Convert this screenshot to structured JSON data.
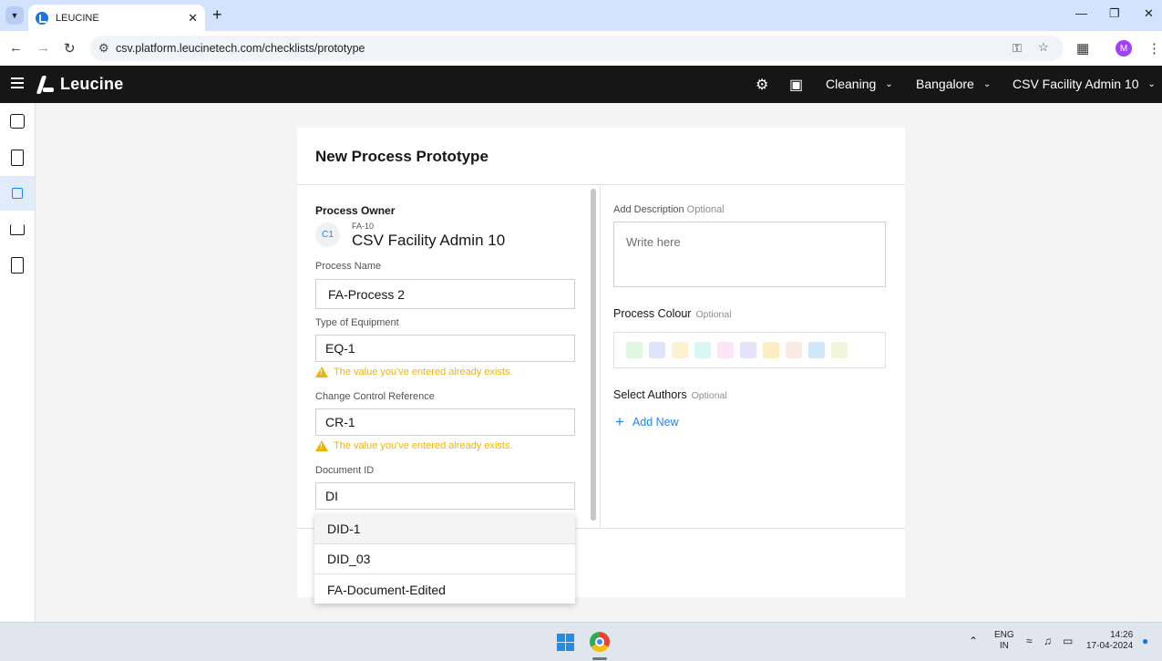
{
  "browser": {
    "tab_title": "LEUCINE",
    "url": "csv.platform.leucinetech.com/checklists/prototype",
    "profile_initial": "M"
  },
  "header": {
    "brand": "Leucine",
    "facility_use_case": "Cleaning",
    "location": "Bangalore",
    "user": "CSV Facility Admin 10"
  },
  "sidebar": {
    "items": [
      {
        "icon": "inbox-icon",
        "active": false
      },
      {
        "icon": "checklist-icon",
        "active": false
      },
      {
        "icon": "prototype-icon",
        "active": true
      },
      {
        "icon": "hierarchy-icon",
        "active": false
      },
      {
        "icon": "calculator-icon",
        "active": false
      }
    ]
  },
  "form": {
    "title": "New Process Prototype",
    "owner_label": "Process Owner",
    "owner_avatar": "C1",
    "owner_code": "FA-10",
    "owner_name": "CSV Facility Admin 10",
    "process_name_label": "Process Name",
    "process_name_value": "FA-Process 2",
    "equipment_label": "Type of Equipment",
    "equipment_value": "EQ-1",
    "equipment_warning": "The value you've entered already exists.",
    "ccr_label": "Change Control Reference",
    "ccr_value": "CR-1",
    "ccr_warning": "The value you've entered already exists.",
    "doc_id_label": "Document ID",
    "doc_id_value": "DI",
    "doc_id_options": [
      "DID-1",
      "DID_03",
      "FA-Document-Edited"
    ],
    "description_label": "Add Description",
    "description_optional": "Optional",
    "description_placeholder": "Write here",
    "colour_label": "Process Colour",
    "colour_optional": "Optional",
    "colours": [
      "#e0f7e0",
      "#dde4fb",
      "#fdf1d1",
      "#d9f8f5",
      "#fde4f6",
      "#e5e2fb",
      "#fbeec0",
      "#fae9e4",
      "#cde6fb",
      "#eff6da"
    ],
    "authors_label": "Select Authors",
    "authors_optional": "Optional",
    "add_new_label": "Add New"
  },
  "taskbar": {
    "lang_top": "ENG",
    "lang_bottom": "IN",
    "time": "14:26",
    "date": "17-04-2024"
  }
}
